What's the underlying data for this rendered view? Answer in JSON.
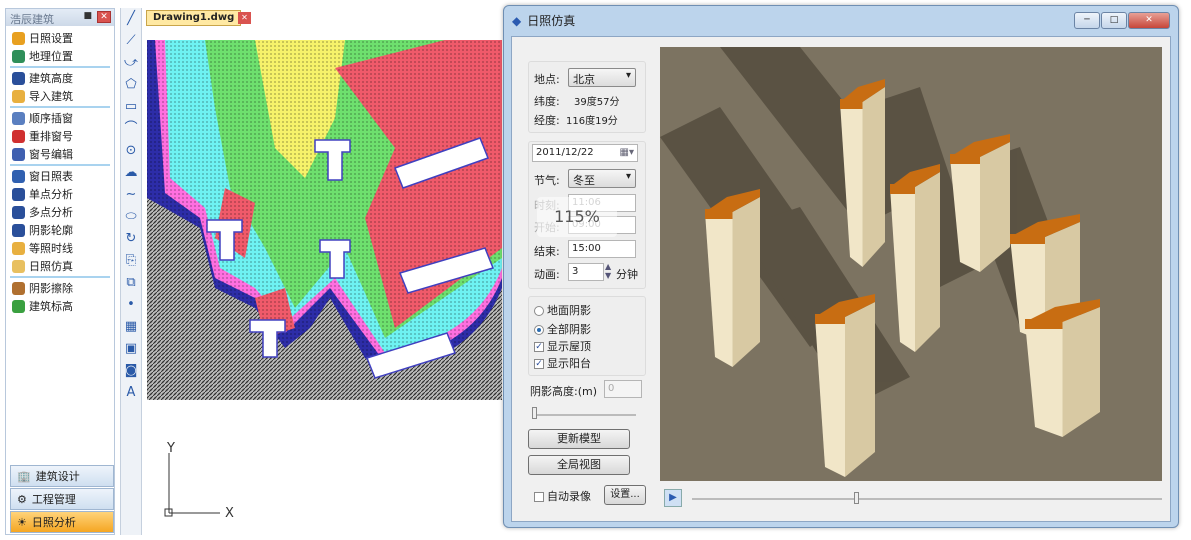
{
  "panel": {
    "title": "浩辰建筑",
    "items": [
      {
        "label": "日照设置",
        "color": "#e8a020"
      },
      {
        "label": "地理位置",
        "color": "#2f8f5a"
      },
      {
        "label": "建筑高度",
        "color": "#2a4f9a"
      },
      {
        "label": "导入建筑",
        "color": "#e8b040"
      },
      {
        "label": "顺序插窗",
        "color": "#5a7fc0"
      },
      {
        "label": "重排窗号",
        "color": "#d03030"
      },
      {
        "label": "窗号编辑",
        "color": "#4060b0"
      },
      {
        "label": "窗日照表",
        "color": "#3060b0"
      },
      {
        "label": "单点分析",
        "color": "#2a4f9a"
      },
      {
        "label": "多点分析",
        "color": "#2a4f9a"
      },
      {
        "label": "阴影轮廓",
        "color": "#2a4f9a"
      },
      {
        "label": "等照时线",
        "color": "#e8b040"
      },
      {
        "label": "日照仿真",
        "color": "#e8c060"
      },
      {
        "label": "阴影擦除",
        "color": "#b07030"
      },
      {
        "label": "建筑标高",
        "color": "#3aa040"
      }
    ],
    "tabs": [
      {
        "label": "建筑设计"
      },
      {
        "label": "工程管理"
      },
      {
        "label": "日照分析"
      }
    ]
  },
  "toolbar": [
    "╱",
    "⟋",
    "⤻",
    "⬠",
    "▭",
    "⌒",
    "⊙",
    "☁",
    "∼",
    "⬭",
    "↻",
    "⎘",
    "⧉",
    "•",
    "▦",
    "▣",
    "◙",
    "A"
  ],
  "document": {
    "tab": "Drawing1.dwg",
    "axis_x": "X",
    "axis_y": "Y"
  },
  "dialog": {
    "title": "日照仿真",
    "location_label": "地点:",
    "location": "北京",
    "lat_label": "纬度:",
    "lat": "39度57分",
    "lon_label": "经度:",
    "lon": "116度19分",
    "date": "2011/12/22",
    "term_label": "节气:",
    "term": "冬至",
    "time_label": "时刻:",
    "time": "11:06",
    "start_label": "开始:",
    "start": "09:00",
    "end_label": "结束:",
    "end": "15:00",
    "anim_label": "动画:",
    "anim": "3",
    "anim_unit": "分钟",
    "ground_shadow": "地面阴影",
    "all_shadow": "全部阴影",
    "show_roof": "显示屋顶",
    "show_balcony": "显示阳台",
    "shadow_height_label": "阴影高度:(m)",
    "shadow_height": "0",
    "update_btn": "更新模型",
    "full_view_btn": "全局视图",
    "auto_record": "自动录像",
    "settings_btn": "设置...",
    "zoom_tip": "115%"
  }
}
